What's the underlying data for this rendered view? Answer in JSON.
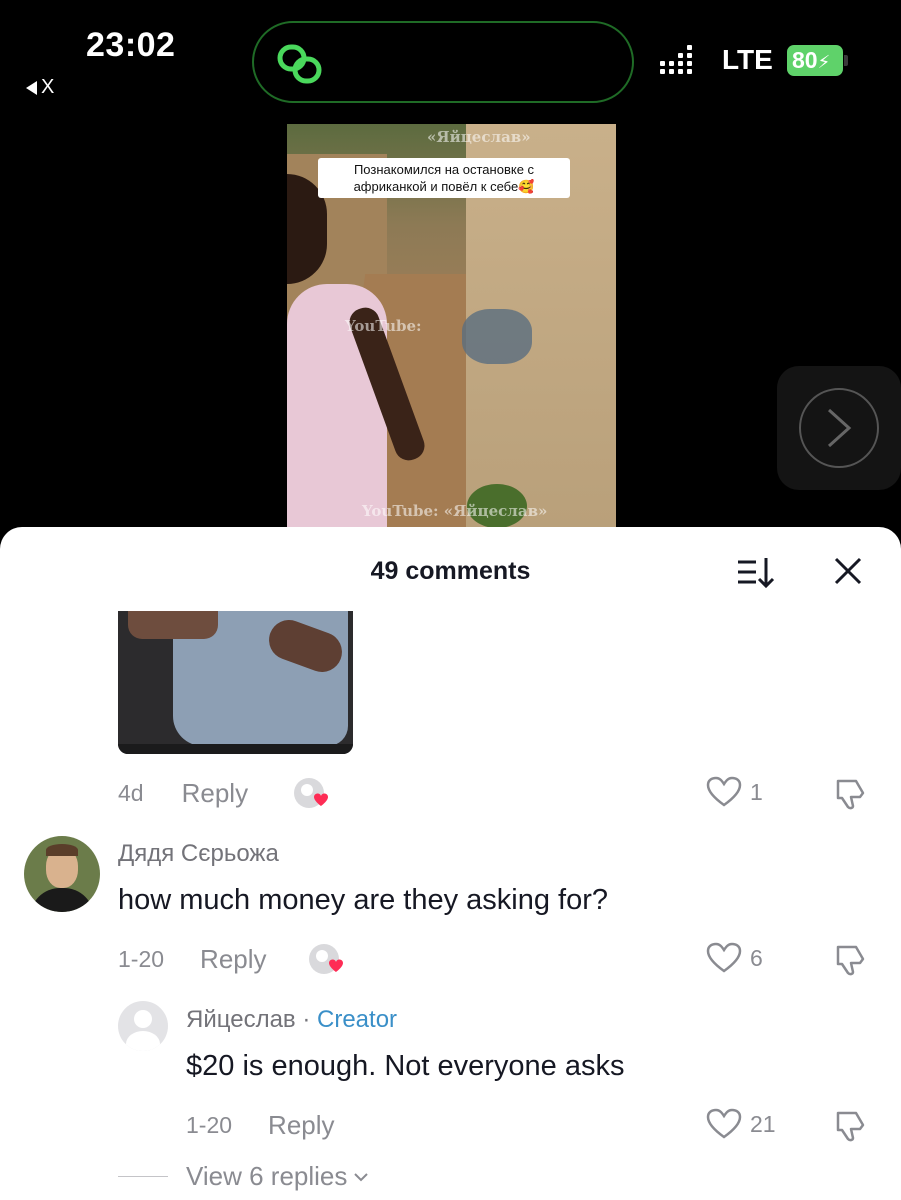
{
  "status_bar": {
    "time": "23:02",
    "back_label": "X",
    "network": "LTE",
    "battery": "80",
    "battery_color": "#5fd26a"
  },
  "video": {
    "caption": "Познакомился на остановке с африканкой и повёл к себе🥰",
    "watermark_top": "«Яйцеслав»",
    "watermark_mid": "YouTube:",
    "watermark_bottom": "YouTube: «Яйцеслав»"
  },
  "panel": {
    "title": "49 comments"
  },
  "comments": [
    {
      "time": "4d",
      "reply_label": "Reply",
      "likes": "1"
    },
    {
      "user": "Дядя Сєрьожа",
      "text": "how much money are they asking for?",
      "time": "1-20",
      "reply_label": "Reply",
      "likes": "6"
    },
    {
      "user": "Яйцеслав",
      "separator": " · ",
      "badge": "Creator",
      "badge_color": "#3a8fc8",
      "text": "$20 is enough. Not everyone asks",
      "time": "1-20",
      "reply_label": "Reply",
      "likes": "21"
    }
  ],
  "view_replies": "View 6 replies",
  "icons": [
    "link-icon",
    "next-arrow-icon",
    "sort-icon",
    "close-icon",
    "heart-icon",
    "dislike-icon",
    "creator-liked-icon",
    "chevron-down-icon"
  ]
}
